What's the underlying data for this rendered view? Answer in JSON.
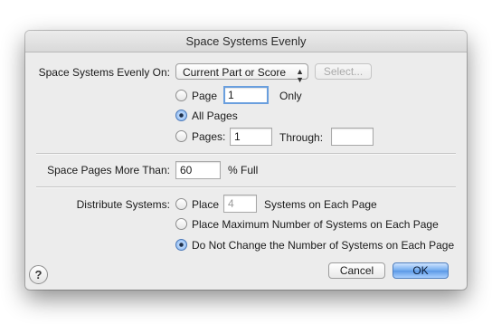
{
  "dialog": {
    "title": "Space Systems Evenly"
  },
  "space_on": {
    "label": "Space Systems Evenly On:",
    "popup_value": "Current Part or Score",
    "select_button": "Select..."
  },
  "pages": {
    "page_label": "Page",
    "page_value": "1",
    "only_label": "Only",
    "all_pages_label": "All Pages",
    "pages_label": "Pages:",
    "from_value": "1",
    "through_label": "Through:",
    "through_value": "",
    "selected": "all_pages"
  },
  "space_more": {
    "label": "Space Pages More Than:",
    "value": "60",
    "unit": "% Full"
  },
  "distribute": {
    "label": "Distribute Systems:",
    "place_label": "Place",
    "place_value": "4",
    "systems_each_label": "Systems on Each Page",
    "place_max_label": "Place Maximum Number of Systems on Each Page",
    "no_change_label": "Do Not Change the Number of Systems on Each Page",
    "selected": "no_change"
  },
  "buttons": {
    "cancel": "Cancel",
    "ok": "OK",
    "help": "?"
  },
  "colors": {
    "dialog_bg": "#ececec",
    "default_button": "#6fa9ee",
    "focus_ring": "#6a9fde"
  }
}
